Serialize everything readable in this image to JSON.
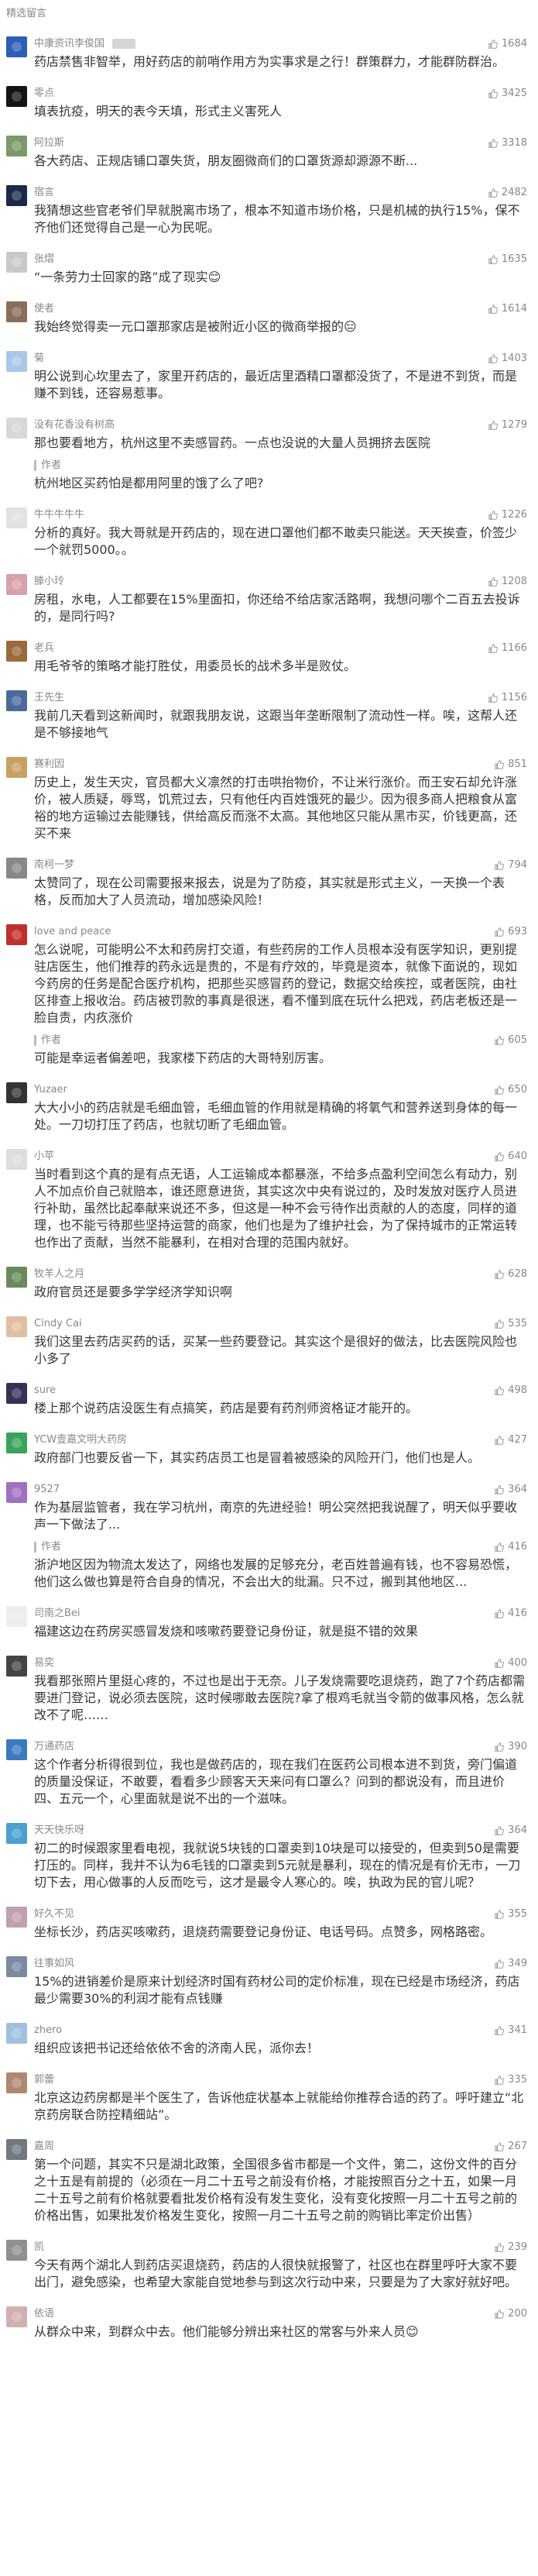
{
  "section_title": "精选留言",
  "icons": {
    "like": "thumbs-up-icon"
  },
  "colors": {
    "text": "#353535",
    "meta": "#888888",
    "like_icon": "#999999",
    "reply_bar": "#bbbbbb"
  },
  "comments": [
    {
      "name": "中康资讯李俊国",
      "badge": true,
      "likes": "1684",
      "avatar_color": "#2b5fb3",
      "text": "药店禁售非智举，用好药店的前哨作用方为实事求是之行！群策群力，才能群防群治。"
    },
    {
      "name": "零点",
      "likes": "3425",
      "avatar_color": "#141414",
      "text": "填表抗疫，明天的表今天填，形式主义害死人"
    },
    {
      "name": "阿拉斯",
      "likes": "3318",
      "avatar_color": "#7a9a6a",
      "text": "各大药店、正规店铺口罩失货，朋友圈微商们的口罩货源却源源不断..."
    },
    {
      "name": "宿言",
      "likes": "2482",
      "avatar_color": "#1b2a4a",
      "text": "我猜想这些官老爷们早就脱离市场了，根本不知道市场价格，只是机械的执行15%，保不齐他们还觉得自己是一心为民呢。"
    },
    {
      "name": "张熠",
      "likes": "1635",
      "avatar_color": "#c9c9c9",
      "text": "“一条劳力士回家的路”成了现实😊"
    },
    {
      "name": "使者",
      "likes": "1614",
      "avatar_color": "#8a6d5a",
      "text": "我始终觉得卖一元口罩那家店是被附近小区的微商举报的😑"
    },
    {
      "name": "菊",
      "likes": "1403",
      "avatar_color": "#a8c8e8",
      "text": "明公说到心坎里去了，家里开药店的，最近店里酒精口罩都没货了，不是进不到货，而是赚不到钱，还容易惹事。"
    },
    {
      "name": "没有花香没有树高",
      "likes": "1279",
      "avatar_color": "#d8d8d8",
      "text": "那也要看地方，杭州这里不卖感冒药。一点也没说的大量人员拥挤去医院",
      "reply": {
        "label": "作者",
        "likes": "",
        "text": "杭州地区买药怕是都用阿里的饿了么了吧?"
      }
    },
    {
      "name": "牛牛牛牛牛",
      "likes": "1226",
      "avatar_color": "#e2e2e2",
      "text": "分析的真好。我大哥就是开药店的，现在进口罩他们都不敢卖只能送。天天挨查，价签少一个就罚5000。。"
    },
    {
      "name": "滕小玲",
      "likes": "1208",
      "avatar_color": "#d8a0a8",
      "text": "房租，水电，人工都要在15%里面扣，你还给不给店家活路啊，我想问哪个二百五去投诉的，是同行吗?"
    },
    {
      "name": "老兵",
      "likes": "1166",
      "avatar_color": "#9a6a3a",
      "text": "用毛爷爷的策略才能打胜仗，用委员长的战术多半是败仗。"
    },
    {
      "name": "王先生",
      "likes": "1156",
      "avatar_color": "#4a6a9a",
      "text": "我前几天看到这新闻时，就跟我朋友说，这跟当年垄断限制了流动性一样。唉，这帮人还是不够接地气"
    },
    {
      "name": "赛利因",
      "likes": "851",
      "avatar_color": "#c8a060",
      "text": "历史上，发生天灾，官员都大义凛然的打击哄抬物价，不让米行涨价。而王安石却允许涨价，被人质疑，辱骂，饥荒过去，只有他任内百姓饿死的最少。因为很多商人把粮食从富裕的地方运输过去能赚钱，供给高反而涨不太高。其他地区只能从黑市买，价钱更高，还买不来"
    },
    {
      "name": "南柯一梦",
      "likes": "794",
      "avatar_color": "#888888",
      "text": "太赞同了，现在公司需要报来报去，说是为了防疫，其实就是形式主义，一天换一个表格，反而加大了人员流动，增加感染风险！"
    },
    {
      "name": "love and peace",
      "likes": "693",
      "avatar_color": "#c0302a",
      "text": "怎么说呢，可能明公不太和药房打交道，有些药房的工作人员根本没有医学知识，更别提驻店医生，他们推荐的药永远是贵的，不是有疗效的，毕竟是资本，就像下面说的，现如今药房的任务是配合医疗机构，把那些买感冒药的登记，数据交给疾控，或者医院，由社区排查上报收治。药店被罚款的事真是很迷，看不懂到底在玩什么把戏，药店老板还是一脸自责，内疚涨价",
      "reply": {
        "label": "作者",
        "likes": "605",
        "text": "可能是幸运者偏差吧，我家楼下药店的大哥特别厉害。"
      }
    },
    {
      "name": "Yuzaer",
      "likes": "650",
      "avatar_color": "#333333",
      "text": "大大小小的药店就是毛细血管，毛细血管的作用就是精确的将氧气和营养送到身体的每一处。一刀切打压了药店，也就切断了毛细血管。"
    },
    {
      "name": "小苹",
      "likes": "640",
      "avatar_color": "#dddddd",
      "text": "当时看到这个真的是有点无语，人工运输成本都暴涨，不给多点盈利空间怎么有动力，别人不加点价自己就赔本，谁还愿意进货，其实这次中央有说过的，及时发放对医疗人员进行补助，虽然比起奉献来说还不多，但这是一种不会亏待作出贡献的人的态度，同样的道理，也不能亏待那些坚持运营的商家，他们也是为了维护社会，为了保持城市的正常运转也作出了贡献，当然不能暴利，在相对合理的范围内就好。"
    },
    {
      "name": "牧羊人之月",
      "likes": "628",
      "avatar_color": "#6a8a5a",
      "text": "政府官员还是要多学学经济学知识啊"
    },
    {
      "name": "Cindy Cai",
      "likes": "535",
      "avatar_color": "#e0c0a0",
      "text": "我们这里去药店买药的话，买某一些药要登记。其实这个是很好的做法，比去医院风险也小多了"
    },
    {
      "name": "sure",
      "likes": "498",
      "avatar_color": "#333355",
      "text": "楼上那个说药店没医生有点搞笑，药店是要有药剂师资格证才能开的。"
    },
    {
      "name": "YCW壹嘉文明大药房",
      "likes": "427",
      "avatar_color": "#3aa35a",
      "text": "政府部门也要反省一下，其实药店员工也是冒着被感染的风险开门，他们也是人。"
    },
    {
      "name": "9527",
      "likes": "364",
      "avatar_color": "#a070c0",
      "text": "作为基层监管者，我在学习杭州，南京的先进经验！明公突然把我说醒了，明天似乎要收声一下做法了...",
      "reply": {
        "label": "作者",
        "likes": "416",
        "text": "浙沪地区因为物流太发达了，网络也发展的足够充分，老百姓普遍有钱，也不容易恐慌，他们这么做也算是符合自身的情况，不会出大的纰漏。只不过，搬到其他地区..."
      }
    },
    {
      "name": "司南之Bei",
      "likes": "416",
      "avatar_color": "#eeeeee",
      "text": "福建这边在药房买感冒发烧和咳嗽药要登记身份证，就是挺不错的效果"
    },
    {
      "name": "易奕",
      "likes": "400",
      "avatar_color": "#444444",
      "text": "我看那张照片里挺心疼的，不过也是出于无奈。儿子发烧需要吃退烧药，跑了7个药店都需要进门登记，说必须去医院，这时候哪敢去医院?拿了根鸡毛就当令箭的做事风格，怎么就改不了呢……"
    },
    {
      "name": "万通药店",
      "likes": "390",
      "avatar_color": "#3a7ac0",
      "text": "这个作者分析得很到位，我也是做药店的，现在我们在医药公司根本进不到货，旁门偏道的质量没保证，不敢要，看看多少顾客天天来问有口罩么？问到的都说没有，而且进价四、五元一个，心里面就是说不出的一个滋味。"
    },
    {
      "name": "天天快乐呀",
      "likes": "364",
      "avatar_color": "#4aa0d0",
      "text": "初二的时候跟家里看电视，我就说5块钱的口罩卖到10块是可以接受的，但卖到50是需要打压的。同样，我并不认为6毛钱的口罩卖到5元就是暴利，现在的情况是有价无市，一刀切下去，用心做事的人反而吃亏，这才是最令人寒心的。唉，执政为民的官儿呢？"
    },
    {
      "name": "好久不见",
      "likes": "355",
      "avatar_color": "#c0a0b0",
      "text": "坐标长沙，药店买咳嗽药，退烧药需要登记身份证、电话号码。点赞多，网格路密。"
    },
    {
      "name": "往事如风",
      "likes": "349",
      "avatar_color": "#7a8aa0",
      "text": "15%的进销差价是原来计划经济时国有药材公司的定价标准，现在已经是市场经济，药店最少需要30%的利润才能有点钱赚"
    },
    {
      "name": "zhero",
      "likes": "341",
      "avatar_color": "#a0c0e0",
      "text": "组织应该把书记还给依依不舍的济南人民，派你去！"
    },
    {
      "name": "郭蕾",
      "likes": "335",
      "avatar_color": "#b08870",
      "text": "北京这边药房都是半个医生了，告诉他症状基本上就能给你推荐合适的药了。呼吁建立“北京药房联合防控精细站”。"
    },
    {
      "name": "嘉周",
      "likes": "267",
      "avatar_color": "#707880",
      "text": "第一个问题，其实不只是湖北政策，全国很多省市都是一个文件，第二，这份文件的百分之十五是有前提的（必须在一月二十五号之前没有价格，才能按照百分之十五，如果一月二十五号之前有价格就要看批发价格有没有发生变化，没有变化按照一月二十五号之前的价格出售，如果批发价格发生变化，按照一月二十五号之前的购销比率定价出售）"
    },
    {
      "name": "凯",
      "likes": "239",
      "avatar_color": "#909090",
      "text": "今天有两个湖北人到药店买退烧药，药店的人很快就报警了，社区也在群里呼吁大家不要出门，避免感染，也希望大家能自觉地参与到这次行动中来，只要是为了大家好就好吧。"
    },
    {
      "name": "依语",
      "likes": "200",
      "avatar_color": "#d0b0b0",
      "text": "从群众中来，到群众中去。他们能够分辨出来社区的常客与外来人员😊"
    }
  ]
}
